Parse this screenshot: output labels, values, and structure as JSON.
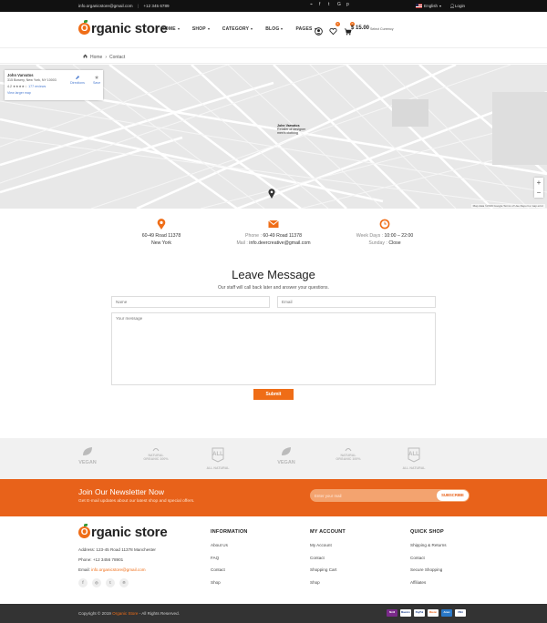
{
  "topbar": {
    "email": "info.organicstore@gmail.com",
    "separator": "|",
    "phone": "+12 345 6789",
    "social_icons": [
      "rss-icon",
      "facebook-icon",
      "twitter-icon",
      "google-plus-icon",
      "pinterest-icon"
    ],
    "language": "English",
    "login": "Login"
  },
  "header": {
    "logo_letter": "O",
    "logo_text": "rganic store",
    "nav": [
      {
        "label": "HOME"
      },
      {
        "label": "SHOP"
      },
      {
        "label": "CATEGORY"
      },
      {
        "label": "BLOG"
      },
      {
        "label": "PAGES"
      }
    ],
    "wishlist_count": "0",
    "cart_count": "0",
    "cart_total": "$ 15.00",
    "currency": "Select Currency"
  },
  "breadcrumb": {
    "home": "Home",
    "separator": "›",
    "current": "Contact"
  },
  "map": {
    "place_name": "John Varvatos",
    "address": "315 Bowery, New York, NY 10003",
    "rating": "4.2 ★★★★☆",
    "reviews": "177 reviews",
    "larger_map": "View larger map",
    "directions": "Directions",
    "save": "Save",
    "pin_title": "John Varvatos",
    "pin_sub": "Retailer of designer men's clothing",
    "footer": "Map data ©2019 Google   Terms of Use   Report a map error",
    "zoom_in": "+",
    "zoom_out": "−"
  },
  "contact": {
    "address_line1": "60-49 Road 11378",
    "address_line2": "New York",
    "phone_label": "Phone :",
    "phone_value": "60-49 Road 11378",
    "mail_label": "Mail :",
    "mail_value": "info.deercreative@gmail.com",
    "days_label": "Week Days :",
    "days_value": "10:00 – 22:00",
    "sunday_label": "Sunday :",
    "sunday_value": "Close"
  },
  "form": {
    "title": "Leave Message",
    "subtitle": "Our staff will call back later and answer your questions.",
    "name_placeholder": "Name",
    "email_placeholder": "Email",
    "message_placeholder": "Your message",
    "submit": "Submit"
  },
  "brands": [
    {
      "label": "VEGAN",
      "icon": "leaf-icon"
    },
    {
      "label": "NATURAL ORGANIC 100%",
      "icon": "badge-icon"
    },
    {
      "label": "ALL NATURAL",
      "icon": "stamp-icon"
    },
    {
      "label": "VEGAN",
      "icon": "leaf-icon"
    },
    {
      "label": "NATURAL ORGANIC 100%",
      "icon": "badge-icon"
    },
    {
      "label": "ALL NATURAL",
      "icon": "stamp-icon"
    }
  ],
  "newsletter": {
    "title": "Join Our Newsletter Now",
    "desc": "Get E-mail updates about our latest shop and special offers.",
    "placeholder": "Enter your mail",
    "button": "SUBSCRIBE"
  },
  "footer": {
    "address": "Address: 123-45 Road 11378 Manchester",
    "phone": "Phone: +12 3456 78901",
    "email_label": "Email:",
    "email_value": "info.organicstore@gmail.com",
    "social": [
      "f",
      "◎",
      "t",
      "℗"
    ],
    "columns": [
      {
        "title": "INFORMATION",
        "links": [
          "About Us",
          "FAQ",
          "Contact",
          "Shop"
        ]
      },
      {
        "title": "MY ACCOUNT",
        "links": [
          "My Account",
          "Contact",
          "Shopping Cart",
          "Shop"
        ]
      },
      {
        "title": "QUICK SHOP",
        "links": [
          "Shipping & Returns",
          "Contact",
          "Secure Shopping",
          "Affiliates"
        ]
      }
    ]
  },
  "copyright": {
    "prefix": "Copyright © 2019",
    "brand": "Organic Store",
    "suffix": "- All Rights Reserved.",
    "payments": [
      "Skrill",
      "Maestro",
      "PayPal",
      "Master",
      "Amex",
      "VISA"
    ]
  },
  "colors": {
    "accent": "#ef6d17",
    "newsletter": "#e8621a",
    "dark": "#111111"
  }
}
